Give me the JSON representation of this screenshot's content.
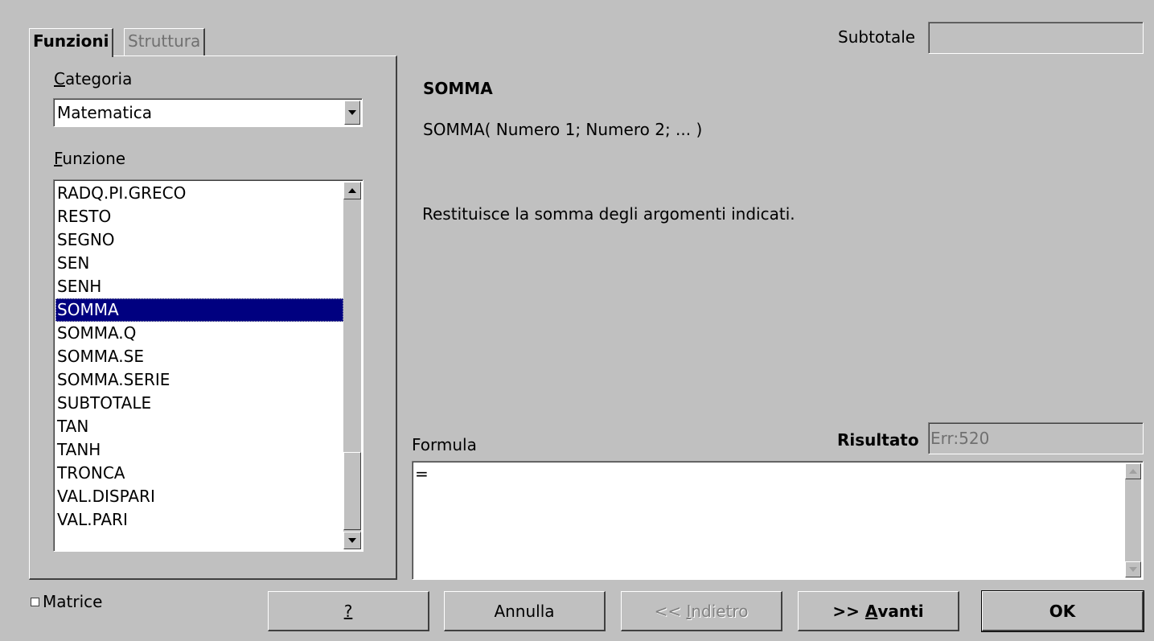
{
  "tabs": [
    {
      "label": "Funzioni",
      "active": true
    },
    {
      "label": "Struttura",
      "active": false
    }
  ],
  "subtotal": {
    "label": "Subtotale",
    "value": ""
  },
  "category": {
    "label_first": "C",
    "label_rest": "ategoria",
    "value": "Matematica"
  },
  "function": {
    "label_first": "F",
    "label_rest": "unzione",
    "items": [
      "RADQ.PI.GRECO",
      "RESTO",
      "SEGNO",
      "SEN",
      "SENH",
      "SOMMA",
      "SOMMA.Q",
      "SOMMA.SE",
      "SOMMA.SERIE",
      "SUBTOTALE",
      "TAN",
      "TANH",
      "TRONCA",
      "VAL.DISPARI",
      "VAL.PARI"
    ],
    "selected": "SOMMA"
  },
  "info": {
    "name": "SOMMA",
    "syntax": "SOMMA( Numero 1; Numero 2; ... )",
    "description": "Restituisce la somma degli argomenti indicati."
  },
  "formula": {
    "label": "Formula",
    "value": "="
  },
  "result": {
    "label": "Risultato",
    "value": "Err:520"
  },
  "matrix": {
    "label": "Matrice",
    "checked": false
  },
  "buttons": {
    "help": "?",
    "cancel": "Annulla",
    "back_prefix": "<< ",
    "back_underlined": "I",
    "back_rest": "ndietro",
    "next_prefix": ">> ",
    "next_underlined": "A",
    "next_rest": "vanti",
    "ok": "OK"
  },
  "icons": {
    "combo_arrow": "chevron-down-icon",
    "scroll_up": "scroll-up-icon",
    "scroll_down": "scroll-down-icon"
  },
  "colors": {
    "selection": "#000080",
    "dialog_bg": "#c0c0c0"
  }
}
